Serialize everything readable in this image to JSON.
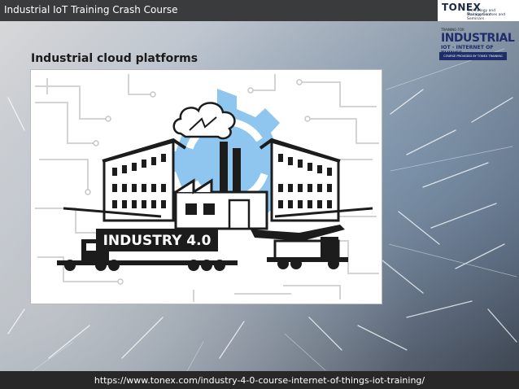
{
  "header": {
    "title": "Industrial IoT Training Crash Course"
  },
  "brand_logo": {
    "name": "TONEX",
    "tagline_1": "Technology and Management",
    "tagline_2": "Training Courses and Seminars"
  },
  "course_logo": {
    "small_text": "TRAINING FOR",
    "title": "INDUSTRIAL",
    "subtitle": "IOT - INTERNET OF THINGS",
    "band_text": "COURSE PROVIDED BY TONEX TRAINING"
  },
  "slide": {
    "heading": "Industrial cloud platforms"
  },
  "illustration": {
    "banner_text": "INDUSTRY 4.0",
    "gear_color": "#8ec6ef",
    "dark_color": "#1c1c1c"
  },
  "footer": {
    "url": "https://www.tonex.com/industry-4-0-course-internet-of-things-iot-training/"
  }
}
